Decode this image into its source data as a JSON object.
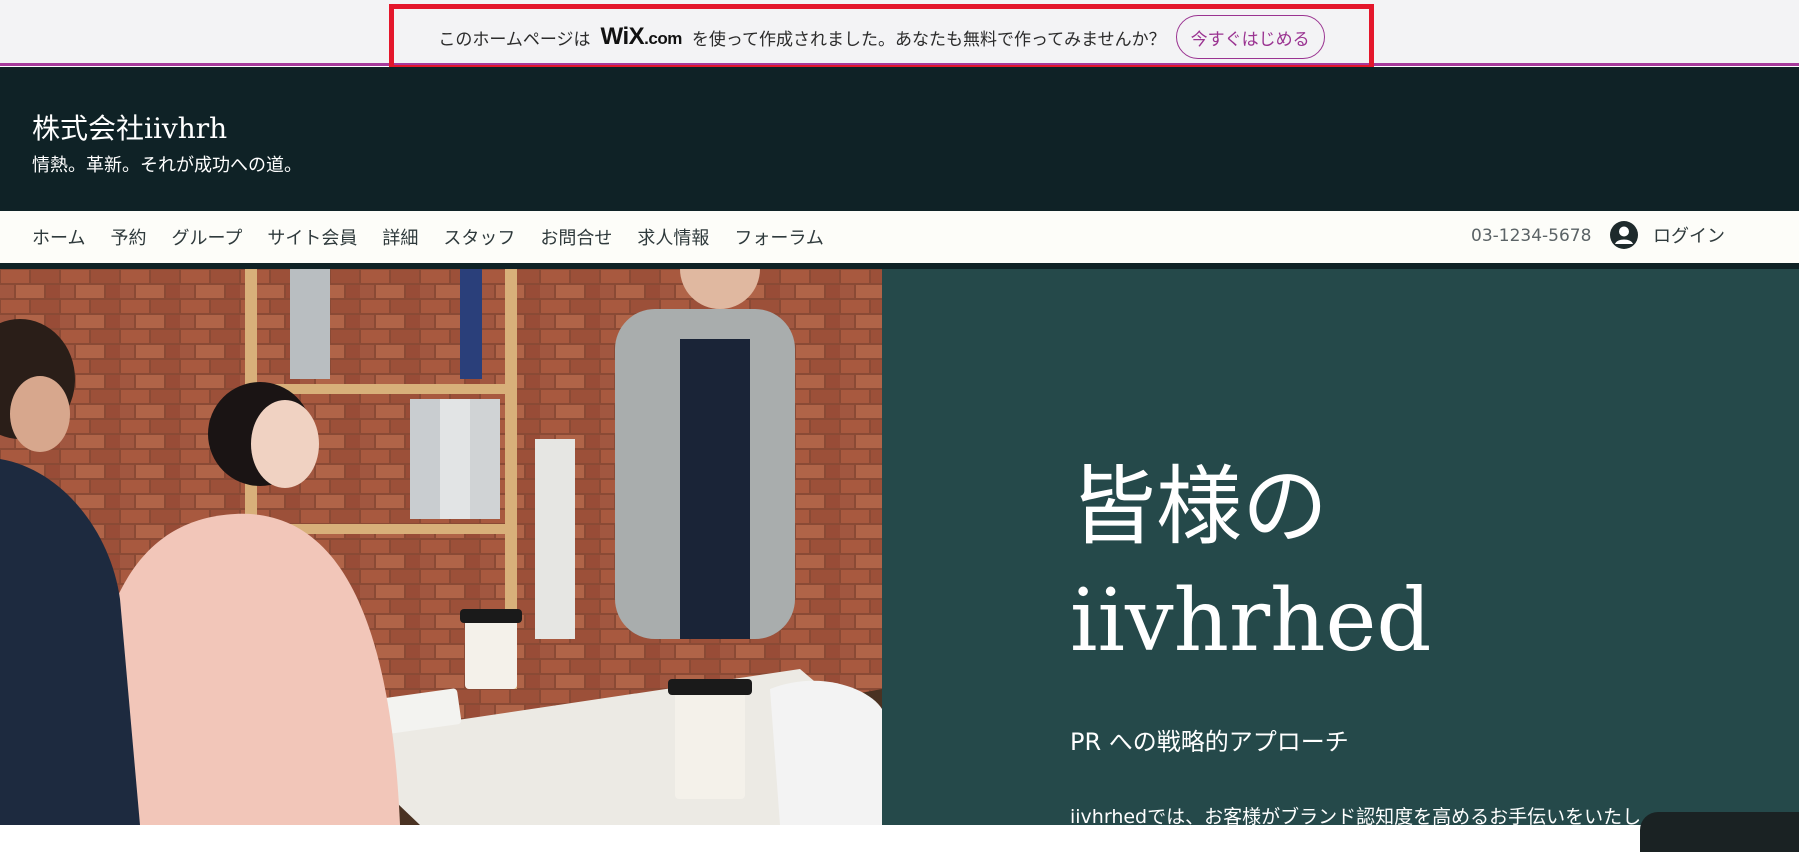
{
  "promo": {
    "text_before": "このホームページは",
    "logo_main": "WiX",
    "logo_suffix": ".com",
    "text_after": "を使って作成されました。あなたも無料で作ってみませんか？",
    "cta_label": "今すぐはじめる",
    "accent_color": "#9a3391",
    "highlight_color": "#e4162b"
  },
  "header": {
    "title": "株式会社iivhrh",
    "tagline": "情熱。革新。それが成功への道。",
    "bg_color": "#0f2226"
  },
  "nav": {
    "items": [
      {
        "label": "ホーム"
      },
      {
        "label": "予約"
      },
      {
        "label": "グループ"
      },
      {
        "label": "サイト会員"
      },
      {
        "label": "詳細"
      },
      {
        "label": "スタッフ"
      },
      {
        "label": "お問合せ"
      },
      {
        "label": "求人情報"
      },
      {
        "label": "フォーラム"
      }
    ],
    "phone": "03-1234-5678",
    "login_label": "ログイン",
    "login_icon": "user-avatar-icon"
  },
  "hero": {
    "title_line1": "皆様の",
    "title_line2": "iivhrhed",
    "subtitle": "PR への戦略的アプローチ",
    "body": "iivhrhedでは、お客様がブランド認知度を高めるお手伝いをいたし",
    "panel_color": "#25494a"
  }
}
